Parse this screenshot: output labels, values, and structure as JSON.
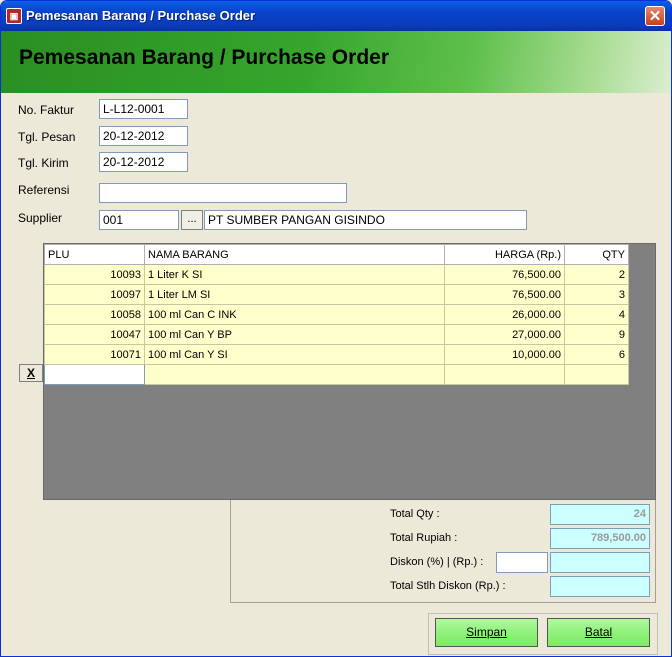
{
  "window": {
    "title": "Pemesanan Barang / Purchase Order",
    "close_symbol": "✕",
    "app_icon_glyph": "▣"
  },
  "header": {
    "title": "Pemesanan Barang / Purchase Order"
  },
  "form": {
    "no_faktur_label": "No. Faktur",
    "no_faktur_value": "L-L12-0001",
    "tgl_pesan_label": "Tgl. Pesan",
    "tgl_pesan_value": "20-12-2012",
    "tgl_kirim_label": "Tgl. Kirim",
    "tgl_kirim_value": "20-12-2012",
    "referensi_label": "Referensi",
    "referensi_value": "",
    "supplier_label": "Supplier",
    "supplier_code": "001",
    "browse_label": "...",
    "supplier_name": "PT SUMBER PANGAN GISINDO"
  },
  "grid": {
    "columns": [
      "PLU",
      "NAMA BARANG",
      "HARGA (Rp.)",
      "QTY"
    ],
    "rows": [
      {
        "plu": "10093",
        "nama": "1 Liter K SI",
        "harga": "76,500.00",
        "qty": "2"
      },
      {
        "plu": "10097",
        "nama": "1 Liter LM SI",
        "harga": "76,500.00",
        "qty": "3"
      },
      {
        "plu": "10058",
        "nama": "100 ml Can C INK",
        "harga": "26,000.00",
        "qty": "4"
      },
      {
        "plu": "10047",
        "nama": "100 ml Can Y BP",
        "harga": "27,000.00",
        "qty": "9"
      },
      {
        "plu": "10071",
        "nama": "100 ml Can Y SI",
        "harga": "10,000.00",
        "qty": "6"
      }
    ],
    "delete_label": "X"
  },
  "summary": {
    "total_qty_label": "Total Qty :",
    "total_qty_value": "24",
    "total_rupiah_label": "Total Rupiah :",
    "total_rupiah_value": "789,500.00",
    "diskon_label": "Diskon (%) | (Rp.) :",
    "diskon_percent": "",
    "diskon_rp": "",
    "total_stlh_label": "Total Stlh Diskon (Rp.) :",
    "total_stlh_value": ""
  },
  "buttons": {
    "simpan": "Simpan",
    "batal": "Batal"
  }
}
